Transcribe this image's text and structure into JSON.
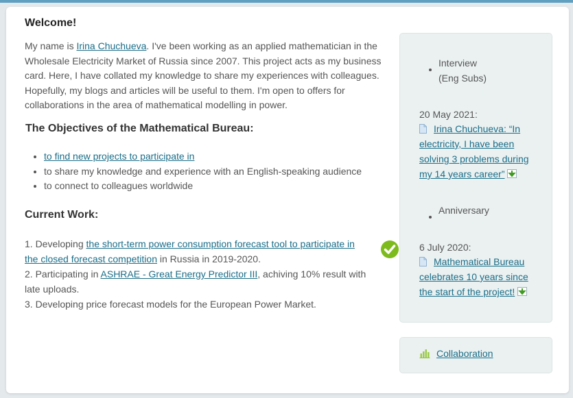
{
  "welcome": {
    "title": "Welcome!",
    "intro_prefix": "My name is ",
    "intro_link": "Irina Chuchueva",
    "intro_suffix": ". I've been working as an applied mathematician in the Wholesale Electricity Market of Russia since 2007. This project acts as my business card. Here, I have collated my knowledge to share my experiences with colleagues. Hopefully, my blogs and articles will be useful to them. I'm open to offers for collaborations in the area of mathematical modelling in power."
  },
  "objectives": {
    "title": "The Objectives of the Mathematical Bureau:",
    "items": [
      "to find new projects to participate in",
      "to share my knowledge and experience with an English-speaking audience",
      "to connect to colleagues worldwide"
    ]
  },
  "current_work": {
    "title": "Current Work:",
    "item1_prefix": "1. Developing ",
    "item1_link": "the short-term power consumption forecast tool to participate in the closed forecast competition",
    "item1_suffix": " in Russia in 2019-2020.",
    "item2_prefix": "2. Participating in ",
    "item2_link": "ASHRAE - Great Energy Predictor III",
    "item2_suffix": ", achiving 10% result with late uploads.",
    "item3": "3. Developing price forecast models for the European Power Market."
  },
  "sidebar": {
    "item1_line1": "Interview",
    "item1_line2": "(Eng Subs)",
    "item1_date": "20 May 2021:",
    "item1_link": "Irina Chuchueva: “In electricity, I have been solving 3 problems during my 14 years career”",
    "item2_label": "Anniversary",
    "item2_date": "6 July 2020:",
    "item2_link": "Mathematical Bureau celebrates 10 years since the start of the project!",
    "collaboration": "Collaboration"
  },
  "icons": {
    "check": "check-circle-icon",
    "document": "document-icon",
    "download": "download-arrow-icon",
    "bars": "bar-chart-icon"
  },
  "colors": {
    "link": "#1a6d88",
    "check": "#7dbb1d",
    "sidebar_bg": "#ebf1f1",
    "top_bar": "#5f9fc0"
  }
}
